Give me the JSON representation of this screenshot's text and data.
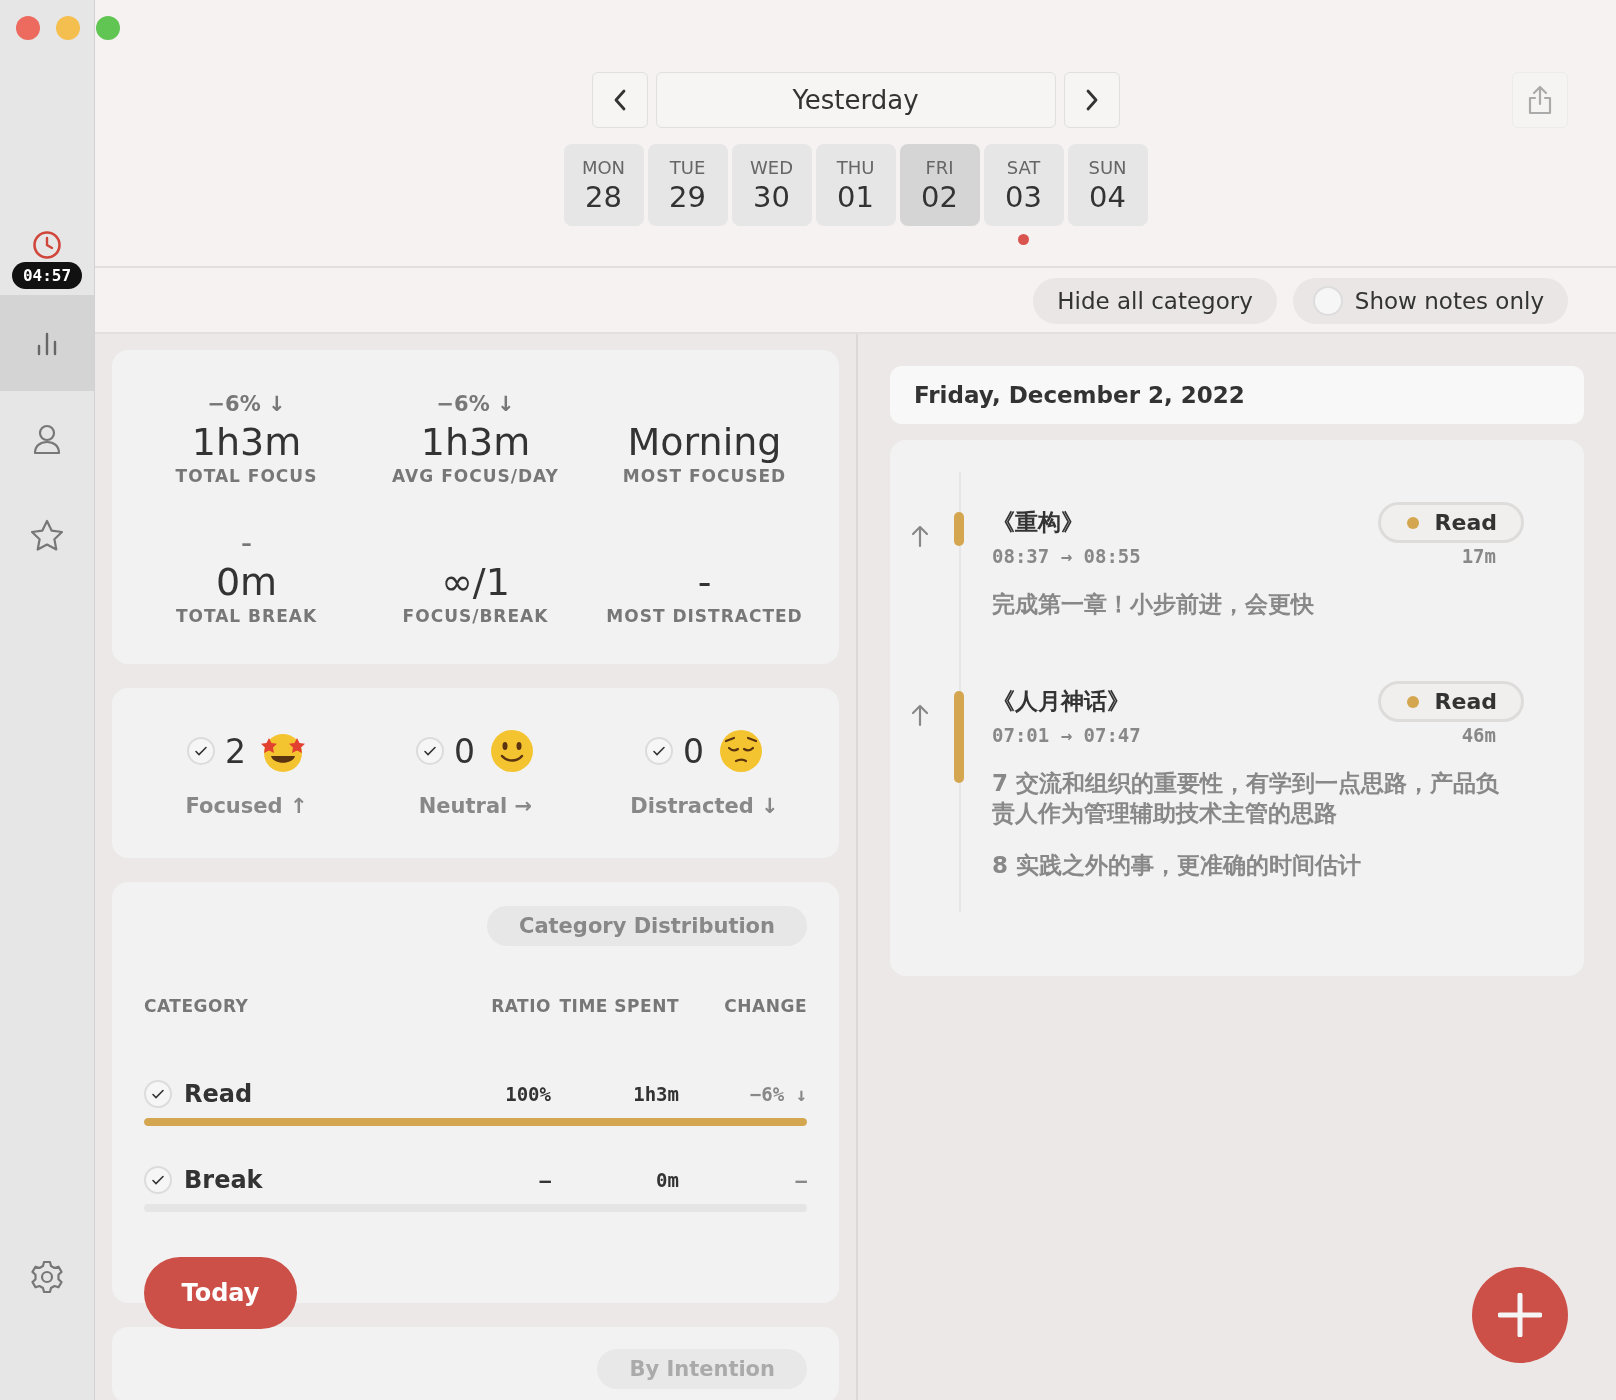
{
  "sidebar": {
    "timer": "04:57",
    "nav": [
      {
        "selected": true
      },
      {
        "selected": false
      },
      {
        "selected": false
      }
    ]
  },
  "header": {
    "date_label": "Yesterday",
    "days": [
      {
        "weekday": "MON",
        "day": "28",
        "selected": false,
        "today": false
      },
      {
        "weekday": "TUE",
        "day": "29",
        "selected": false,
        "today": false
      },
      {
        "weekday": "WED",
        "day": "30",
        "selected": false,
        "today": false
      },
      {
        "weekday": "THU",
        "day": "01",
        "selected": false,
        "today": false
      },
      {
        "weekday": "FRI",
        "day": "02",
        "selected": true,
        "today": false
      },
      {
        "weekday": "SAT",
        "day": "03",
        "selected": false,
        "today": true
      },
      {
        "weekday": "SUN",
        "day": "04",
        "selected": false,
        "today": false
      }
    ]
  },
  "filters": {
    "hide_button": "Hide all category",
    "notes_toggle": {
      "label": "Show notes only",
      "on": false
    }
  },
  "stats": [
    {
      "change": "−6% ↓",
      "value": "1h3m",
      "label": "TOTAL FOCUS"
    },
    {
      "change": "−6% ↓",
      "value": "1h3m",
      "label": "AVG FOCUS/DAY"
    },
    {
      "value": "Morning",
      "label": "MOST FOCUSED"
    },
    {
      "change": "–",
      "value": "0m",
      "label": "TOTAL BREAK"
    },
    {
      "value": "∞/1",
      "label": "FOCUS/BREAK"
    },
    {
      "value": "-",
      "label": "MOST DISTRACTED"
    }
  ],
  "moods": [
    {
      "kind": "focused",
      "checked": true,
      "count": "2",
      "label": "Focused ↑"
    },
    {
      "kind": "neutral",
      "checked": true,
      "count": "0",
      "label": "Neutral →"
    },
    {
      "kind": "distracted",
      "checked": true,
      "count": "0",
      "label": "Distracted ↓"
    }
  ],
  "category_card": {
    "title": "Category Distribution",
    "columns": [
      "CATEGORY",
      "RATIO",
      "TIME SPENT",
      "CHANGE"
    ],
    "rows": [
      {
        "checked": true,
        "name": "Read",
        "ratio": "100%",
        "time": "1h3m",
        "change": "−6% ↓",
        "level": 1,
        "color": "#d4a64f"
      },
      {
        "checked": true,
        "name": "Break",
        "ratio": "–",
        "time": "0m",
        "change": "–",
        "level": 0
      }
    ]
  },
  "today_button": "Today",
  "next_card": {
    "title": "By Intention"
  },
  "journal": {
    "date": "Friday, December 2, 2022",
    "entries": [
      {
        "title": "《重构》",
        "time": "08:37 → 08:55",
        "tag": "Read",
        "color": "#d4a64f",
        "duration": "17m",
        "notes": [
          "完成第一章！小步前进，会更快"
        ]
      },
      {
        "title": "《人月神话》",
        "time": "07:01 → 07:47",
        "tag": "Read",
        "color": "#d4a64f",
        "duration": "46m",
        "notes": [
          "7 交流和组织的重要性，有学到一点思路，产品负责人作为管理辅助技术主管的思路",
          "8 实践之外的事，更准确的时间估计"
        ]
      }
    ]
  }
}
